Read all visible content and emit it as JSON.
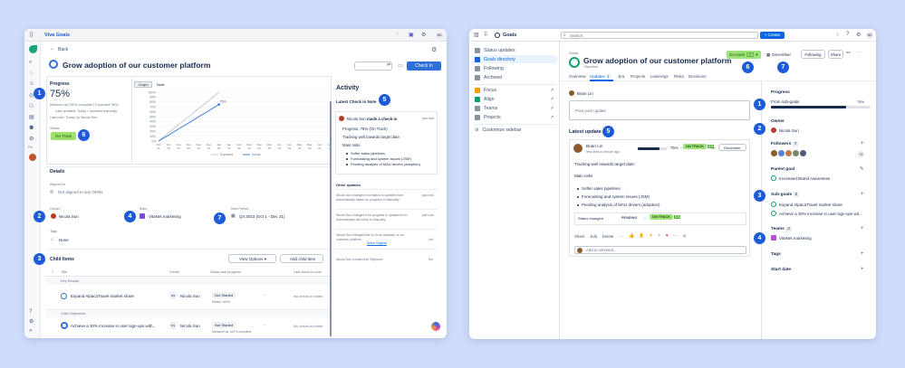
{
  "left": {
    "app_title": "Viva Goals",
    "back": "Back",
    "title": "Grow adoption of our customer platform",
    "checkin_btn": "Check In",
    "progress_label": "Progress",
    "progress_value": "75%",
    "measure_note": "Measure as 100% complete | Expected: 96%",
    "updated_note": "Last updated: Today • Updated manually",
    "last_note": "Last note: Today by Nicola Sun",
    "status_label": "Status",
    "status_value": "On Track",
    "graph_tab": "Graph",
    "table_tab": "Table",
    "chart_y_ticks": [
      "100%",
      "90%",
      "80%",
      "70%",
      "60%",
      "50%",
      "40%",
      "30%",
      "20%",
      "10%",
      "0%"
    ],
    "chart_x_ticks": [
      "Oct 01",
      "Oct 15",
      "Nov 01",
      "Nov 15",
      "Dec 01",
      "Dec 15",
      "Jan 01",
      "Jan 15",
      "Feb 01",
      "Feb 15",
      "Mar 01",
      "Mar 15",
      "Apr 01",
      "Apr 15",
      "May 01",
      "May 15",
      "Jun 01",
      "Jun 15",
      "Jul 01"
    ],
    "chart_point_label": "75%",
    "legend_expected": "Expected",
    "legend_actual": "Actual",
    "details_label": "Details",
    "aligned_label": "Aligned to",
    "aligned_value": "Not aligned to any OKRs",
    "owner_label": "Owner",
    "owner_value": "Nicola Sun",
    "team_label": "Team",
    "team_value": "VitaNet marketing",
    "period_label": "Time Period",
    "period_value": "Q4 2023 (Oct 1 - Dec 31)",
    "tags_label": "Tags",
    "tags_value": "None",
    "child_items_label": "Child Items",
    "view_options": "View Options",
    "add_child": "Add child item",
    "col_title": "Title",
    "col_owner": "Owner",
    "col_status": "Status and progress",
    "col_checkin": "Last check-in note",
    "group_kr": "Key Results",
    "kr_title": "Expand AlpacaTravel market share",
    "kr_owner": "Nicola Sun",
    "kr_status": "Not Started",
    "kr_reach": "Reach 100%",
    "kr_note": "No check-in notes",
    "group_co": "Child Objectives",
    "co_title": "Achieve a 30% increase in user sign-ups with...",
    "co_owner": "Nicola Sun",
    "co_status": "Not Started",
    "co_measure": "Measure as 100% complete",
    "co_note": "No check-in notes",
    "activity_label": "Activity",
    "latest_checkin": "Latest Check in Note",
    "ci_author": "Nicola Sun",
    "ci_action": "made a check-in",
    "ci_time": "just now",
    "ci_progress": "Progress: 75% (On Track)",
    "ci_text": "Tracking well towards target date.",
    "ci_risks": "Main risks",
    "ci_bullets": [
      "Softer sales pipelines",
      "Forecasting and system issues (JSM)",
      "Pending analysis of MAU drivers (adoption)"
    ],
    "other_updates": "Other updates",
    "upd1": "Nicola Sun changed how status is updated from Automatically based on progress to Manually",
    "upd1_time": "just now",
    "upd2": "Nicola Sun changed how progress is updated from Automatically via rollup to Manually",
    "upd2_time": "just now",
    "upd3": "Nicola Sun changed title to Grow adoption of our customer platform",
    "upd3_link": "Show Original",
    "upd3_time": "4m",
    "upd4": "Nicola Sun created this Objective",
    "upd4_time": "5m",
    "avatar": "NS"
  },
  "right": {
    "app_title": "Goals",
    "search_placeholder": "Search",
    "create_btn": "+ Create",
    "avatar": "NS",
    "nav": [
      "Status updates",
      "Goals directory",
      "Following",
      "Archived"
    ],
    "nav2": [
      "Focus",
      "Align",
      "Teams",
      "Projects"
    ],
    "customize": "Customize sidebar",
    "crumb": "Goals",
    "title": "Grow adoption of our customer platform",
    "subtitle": "Objective",
    "status_btn": "On track",
    "status_score": "0.6",
    "date_btn": "December",
    "following_btn": "Following",
    "share_btn": "Share",
    "tabs": [
      "Overview",
      "Updates",
      "Jira",
      "Projects",
      "Learnings",
      "Risks",
      "Decisions"
    ],
    "updates_count": "1",
    "author": "Brian Lin",
    "post_placeholder": "Post your update",
    "latest_update": "Latest update",
    "upd_author": "Brian Lin",
    "upd_time": "less than a minute ago",
    "upd_pct": "75%",
    "upd_status": "ON TRACK",
    "upd_score": "0.6",
    "upd_for": "for",
    "upd_date": "December",
    "upd_text": "Tracking well towards target date.",
    "upd_risks": "Main risks",
    "upd_bullets": [
      "Softer sales pipelines",
      "Forecasting and system issues (JSM)",
      "Pending analysis of MAU drivers (adoption)"
    ],
    "sc_label": "Status changed",
    "sc_from": "PENDING",
    "sc_to": "ON TRACK",
    "sc_score": "0.6",
    "actions": [
      "Share",
      "Edit",
      "Delete"
    ],
    "comment_placeholder": "Add a comment...",
    "progress_label": "Progress",
    "from_subgoals": "From sub-goals",
    "from_pct": "75%",
    "progress_value": 0.75,
    "owner_label": "Owner",
    "owner_value": "Nicola Sun",
    "followers_label": "Followers",
    "followers_count": "7",
    "followers_more": "+2",
    "parent_label": "Parent goal",
    "parent_value": "Increased Brand Awareness",
    "subgoals_label": "Sub-goals",
    "subgoals_count": "2",
    "sub1": "Expand AlpacaTravel market share",
    "sub2": "Achieve a 30% increase in user sign-ups wit...",
    "teams_label": "Teams",
    "teams_count": "2",
    "team_value": "VitaNet marketing",
    "tags_label": "Tags",
    "start_label": "Start date"
  },
  "badges": [
    "1",
    "2",
    "3",
    "4",
    "5",
    "6",
    "7"
  ],
  "chart_data": {
    "type": "line",
    "title": "",
    "x": [
      "Oct 01",
      "Oct 15",
      "Nov 01",
      "Nov 15",
      "Dec 01",
      "Dec 15",
      "Jan 01"
    ],
    "ylim": [
      0,
      100
    ],
    "series": [
      {
        "name": "Expected",
        "values": [
          0,
          17,
          34,
          50,
          67,
          83,
          100
        ]
      },
      {
        "name": "Actual",
        "values": [
          0,
          12,
          25,
          37,
          50,
          62,
          75
        ]
      }
    ],
    "legend": "bottom"
  }
}
